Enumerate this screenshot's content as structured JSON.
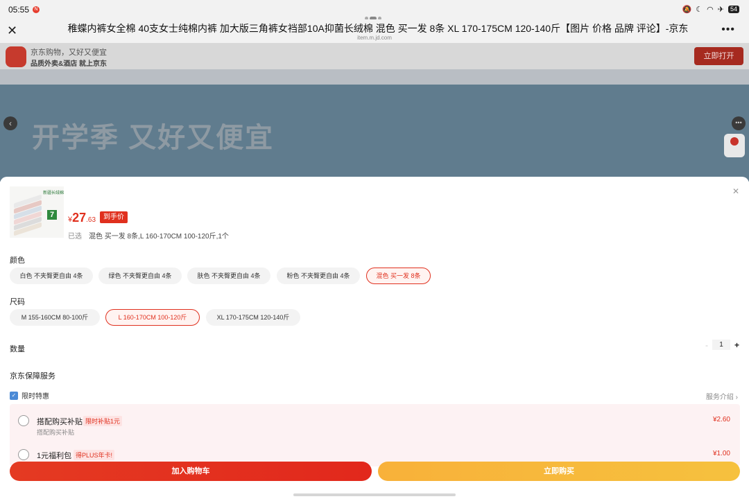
{
  "status_bar": {
    "time": "05:55",
    "notification_badge": "N",
    "battery": "54"
  },
  "browser": {
    "title": "稚蝶内裤女全棉 40支女士纯棉内裤 加大版三角裤女裆部10A抑菌长绒棉 混色 买一发 8条 XL 170-175CM 120-140斤【图片 价格 品牌 评论】-京东",
    "url": "item.m.jd.com"
  },
  "background": {
    "banner_line1": "京东购物，又好又便宜",
    "banner_line2": "品质外卖&酒店 就上京东",
    "open_app": "立即打开",
    "hero_text": "开学季 又好又便宜"
  },
  "product": {
    "thumb_tag": "新疆长绒棉",
    "thumb_count": "7",
    "currency": "¥",
    "price_int": "27",
    "price_dec": ".63",
    "price_badge": "到手价",
    "selected_label": "已选",
    "selected_value": "混色 买一发 8条,L 160-170CM 100-120斤,1个"
  },
  "color": {
    "label": "颜色",
    "options": [
      "白色 不夹臀更自由 4条",
      "绿色 不夹臀更自由 4条",
      "肤色 不夹臀更自由 4条",
      "粉色 不夹臀更自由 4条",
      "混色 买一发 8条"
    ],
    "selected": "混色 买一发 8条"
  },
  "size": {
    "label": "尺码",
    "options": [
      "M 155-160CM 80-100斤",
      "L 160-170CM 100-120斤",
      "XL 170-175CM 120-140斤"
    ],
    "selected": "L 160-170CM 100-120斤"
  },
  "quantity": {
    "label": "数量",
    "value": "1",
    "minus": "-",
    "plus": "+"
  },
  "service": {
    "title": "京东保障服务",
    "limited_label": "限时特惠",
    "intro_link": "服务介绍 ›",
    "items": [
      {
        "name": "搭配购买补贴",
        "tag": "限时补贴1元",
        "sub": "搭配购买补贴",
        "fee": "¥2.60"
      },
      {
        "name": "1元福利包",
        "tag": "得PLUS年卡!",
        "sub": "",
        "fee": "¥1.00"
      }
    ]
  },
  "actions": {
    "add_to_cart": "加入购物车",
    "buy_now": "立即购买"
  },
  "colors": {
    "accent_red": "#e0301e",
    "buy_yellow": "#f8b13a"
  }
}
